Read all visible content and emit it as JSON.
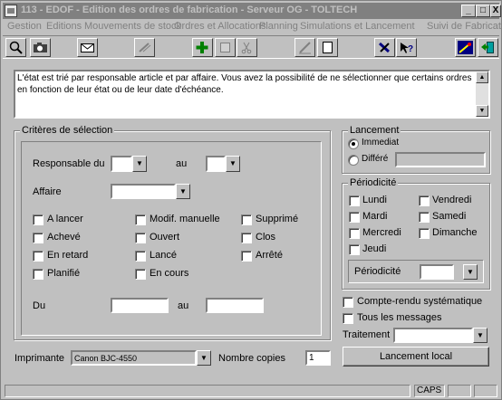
{
  "window": {
    "title": "113 - EDOF - Edition des ordres de fabrication - Serveur OG - TOLTECH",
    "minimize": "_",
    "maximize": "□",
    "close": "X"
  },
  "menu": [
    "Gestion",
    "Editions",
    "Mouvements de stock",
    "Ordres et Allocations",
    "Planning",
    "Simulations et Lancement",
    "Suivi de Fabrication"
  ],
  "toolbar_icons": [
    "search-icon",
    "camera-icon",
    "mail-icon",
    "link-icon",
    "add-icon",
    "stop-icon",
    "cut-icon",
    "edit-icon",
    "new-document-icon",
    "tools-icon",
    "help-icon",
    "run-icon",
    "exit-icon"
  ],
  "info_text": "L'état est trié par responsable article et par affaire. Vous avez la possibilité de ne sélectionner que certains ordres en fonction de leur état ou de leur date d'échéance.",
  "criteria": {
    "title": "Critères de sélection",
    "responsable_label": "Responsable du",
    "au_label": "au",
    "affaire_label": "Affaire",
    "du_label": "Du",
    "du_au_label": "au",
    "checkboxes": [
      {
        "label": "A lancer"
      },
      {
        "label": "Modif. manuelle"
      },
      {
        "label": "Supprimé"
      },
      {
        "label": "Achevé"
      },
      {
        "label": "Ouvert"
      },
      {
        "label": "Clos"
      },
      {
        "label": "En retard"
      },
      {
        "label": "Lancé"
      },
      {
        "label": "Arrêté"
      },
      {
        "label": "Planifié"
      },
      {
        "label": "En cours"
      }
    ]
  },
  "lancement": {
    "title": "Lancement",
    "immediat": "Immediat",
    "differe": "Différé",
    "selected": "Immediat"
  },
  "periodicite": {
    "title": "Périodicité",
    "days": [
      "Lundi",
      "Vendredi",
      "Mardi",
      "Samedi",
      "Mercredi",
      "Dimanche",
      "Jeudi"
    ],
    "button_label": "Périodicité"
  },
  "options": {
    "compte_rendu": "Compte-rendu systématique",
    "tous_messages": "Tous les messages",
    "traitement_label": "Traitement",
    "launch_button": "Lancement local"
  },
  "printer": {
    "label": "Imprimante",
    "value": "Canon  BJC-4550",
    "copies_label": "Nombre copies",
    "copies_value": "1"
  },
  "status": {
    "caps": "CAPS"
  }
}
